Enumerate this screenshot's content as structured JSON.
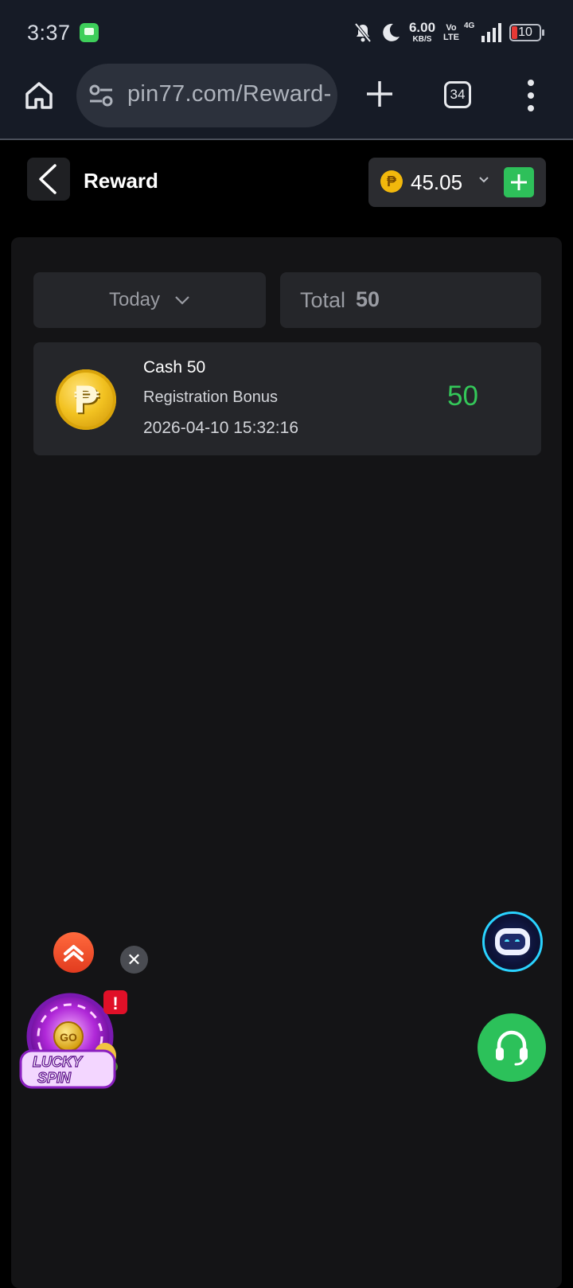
{
  "status_bar": {
    "time": "3:37",
    "speed_value": "6.00",
    "speed_unit": "KB/S",
    "volte_top": "Vo",
    "volte_bottom": "LTE",
    "network": "4G",
    "battery": "10"
  },
  "browser": {
    "url": "pin77.com/Reward-",
    "tab_count": "34"
  },
  "header": {
    "title": "Reward",
    "balance": "45.05",
    "currency_symbol": "₱"
  },
  "filters": {
    "date_label": "Today",
    "total_label": "Total",
    "total_value": "50"
  },
  "rewards": [
    {
      "title": "Cash 50",
      "subtitle": "Registration Bonus",
      "timestamp": "2026-04-10 15:32:16",
      "amount": "50",
      "icon": "peso-coin-icon"
    }
  ],
  "widgets": {
    "lucky_spin_top": "LUCKY",
    "lucky_spin_bottom": "SPIN",
    "lucky_spin_go": "GO",
    "lucky_spin_alert": "!"
  },
  "colors": {
    "accent_green": "#34c759",
    "add_button_green": "#2ec05a",
    "coin_gold": "#f2c221",
    "panel_bg": "#141416",
    "card_bg": "#25262a"
  }
}
